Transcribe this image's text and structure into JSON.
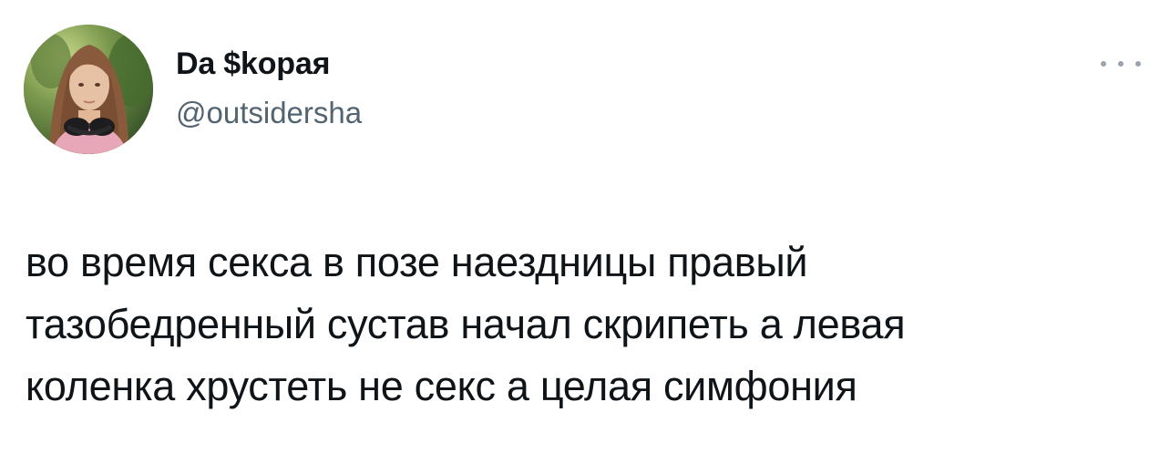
{
  "tweet": {
    "author": {
      "display_name": "Da $kopaя",
      "handle": "@outsidersha",
      "avatar_icon": "profile-photo"
    },
    "more_icon": "more-horizontal-icon",
    "text": "во время секса в позе наездницы правый\nтазобедренный сустав начал скрипеть а левая\nколенка хрустеть не секс а целая симфония"
  },
  "colors": {
    "text_primary": "#0f1419",
    "text_secondary": "#536471",
    "background": "#ffffff"
  }
}
